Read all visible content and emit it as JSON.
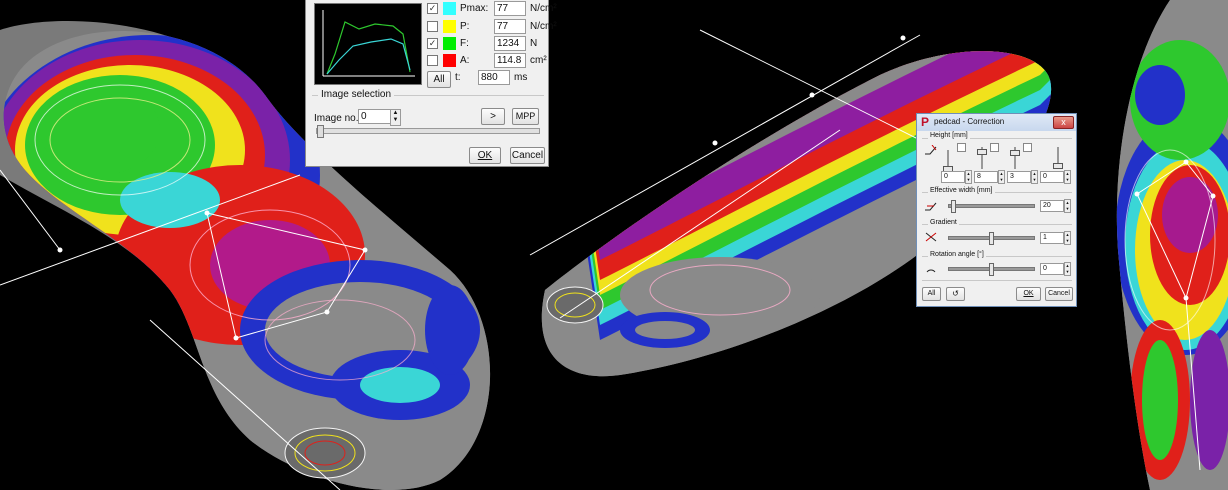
{
  "pressure_panel": {
    "measurements": [
      {
        "label": "Pmax:",
        "value": "77",
        "unit": "N/cm²",
        "checked": true,
        "color": "#33ffff"
      },
      {
        "label": "P:",
        "value": "77",
        "unit": "N/cm²",
        "checked": false,
        "color": "#ffff00"
      },
      {
        "label": "F:",
        "value": "1234",
        "unit": "N",
        "checked": true,
        "color": "#00ee00"
      },
      {
        "label": "A:",
        "value": "114.8",
        "unit": "cm²",
        "checked": false,
        "color": "#ff0000"
      },
      {
        "label": "t:",
        "value": "880",
        "unit": "ms",
        "checked": false,
        "color": null
      }
    ],
    "all_label": "All",
    "image_selection_label": "Image selection",
    "image_no_label": "Image no.:",
    "image_no_value": "0",
    "next_label": ">",
    "mpp_label": "MPP",
    "ok_label": "OK",
    "cancel_label": "Cancel"
  },
  "correction_dialog": {
    "title": "pedcad - Correction",
    "logo": "P",
    "height_label": "Height [mm]",
    "height_values": [
      "0",
      "8",
      "3",
      "0"
    ],
    "effective_width_label": "Effective width [mm]",
    "effective_width_value": "20",
    "gradient_label": "Gradient",
    "gradient_value": "1",
    "rotation_label": "Rotation angle [°]",
    "rotation_value": "0",
    "all_label": "All",
    "undo_icon": "↺",
    "ok_label": "OK",
    "cancel_label": "Cancel",
    "close_icon": "x"
  }
}
